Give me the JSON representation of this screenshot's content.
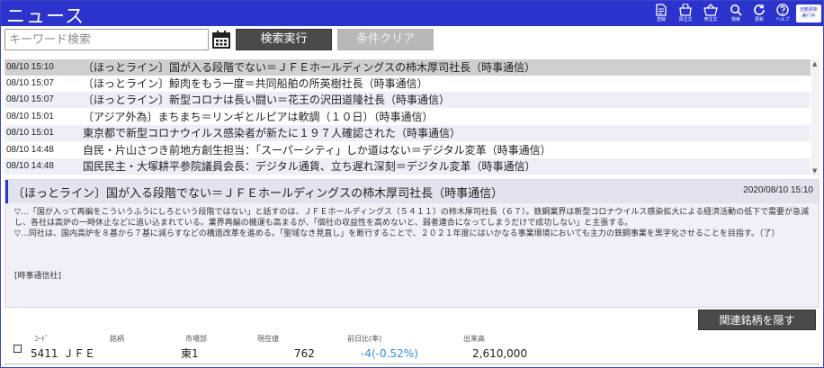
{
  "header": {
    "title": "ニュース",
    "toolbar": [
      {
        "icon": "document-icon",
        "label": "登録"
      },
      {
        "icon": "bag-icon",
        "label": "買注文"
      },
      {
        "icon": "basket-icon",
        "label": "売注文"
      },
      {
        "icon": "search-icon",
        "label": "検索"
      },
      {
        "icon": "refresh-icon",
        "label": "更新"
      },
      {
        "icon": "help-icon",
        "label": "ヘルプ"
      }
    ],
    "auto_update": {
      "line1": "自動更新",
      "line2": "実行中"
    }
  },
  "search": {
    "placeholder": "キーワード検索",
    "value": "",
    "execute_label": "検索実行",
    "clear_label": "条件クリア"
  },
  "news": [
    {
      "time": "08/10 15:10",
      "headline": "〔ほっとライン〕国が入る段階でない＝ＪＦＥホールディングスの柿木厚司社長（時事通信）"
    },
    {
      "time": "08/10 15:07",
      "headline": "〔ほっとライン〕鯨肉をもう一度＝共同船舶の所英樹社長（時事通信）"
    },
    {
      "time": "08/10 15:07",
      "headline": "〔ほっとライン〕新型コロナは長い闘い＝花王の沢田道隆社長（時事通信）"
    },
    {
      "time": "08/10 15:01",
      "headline": "〔アジア外為〕まちまち＝リンギとルピアは軟調（１０日）（時事通信）"
    },
    {
      "time": "08/10 15:01",
      "headline": "東京都で新型コロナウイルス感染者が新たに１９７人確認された（時事通信）"
    },
    {
      "time": "08/10 14:48",
      "headline": "自民・片山さつき前地方創生担当：「スーパーシティ」しか道はない＝デジタル変革（時事通信）"
    },
    {
      "time": "08/10 14:48",
      "headline": "国民民主・大塚耕平参院議員会長：デジタル通貨、立ち遅れ深刻＝デジタル変革（時事通信）"
    }
  ],
  "article": {
    "title": "〔ほっとライン〕国が入る段階でない＝ＪＦＥホールディングスの柿木厚司社長（時事通信）",
    "datetime": "2020/08/10 15:10",
    "paragraph1": "▽…「国が入って再編をこういうふうにしろという段階ではない」と話すのは、ＪＦＥホールディングス（５４１１）の柿木厚司社長（６７）。鉄鋼業界は新型コロナウイルス感染拡大による経済活動の低下で需要が急減し、各社は高炉の一時休止などに追い込まれている。業界再編の機運も高まるが、「個社の収益性を高めないと、弱者連合になってしまうだけで成功しない」と主張する。",
    "paragraph2": "▽…同社は、国内高炉を８基から７基に減らすなどの構造改革を進める。「聖域なき見直し」を断行することで、２０２１年度にはいかなる事業環境においても主力の鉄鋼事業を黒字化させることを目指す。（了）",
    "source": "[時事通信社]"
  },
  "related": {
    "hide_label": "関連銘柄を隠す",
    "columns": {
      "code": "ｺｰﾄﾞ",
      "name": "銘柄",
      "market": "市場部",
      "price": "現在値",
      "change": "前日比(率)",
      "volume": "出来高"
    },
    "rows": [
      {
        "code": "5411",
        "name": "ＪＦＥ",
        "market": "東1",
        "price": "762",
        "change": "-4(-0.52%)",
        "volume": "2,610,000"
      }
    ]
  }
}
